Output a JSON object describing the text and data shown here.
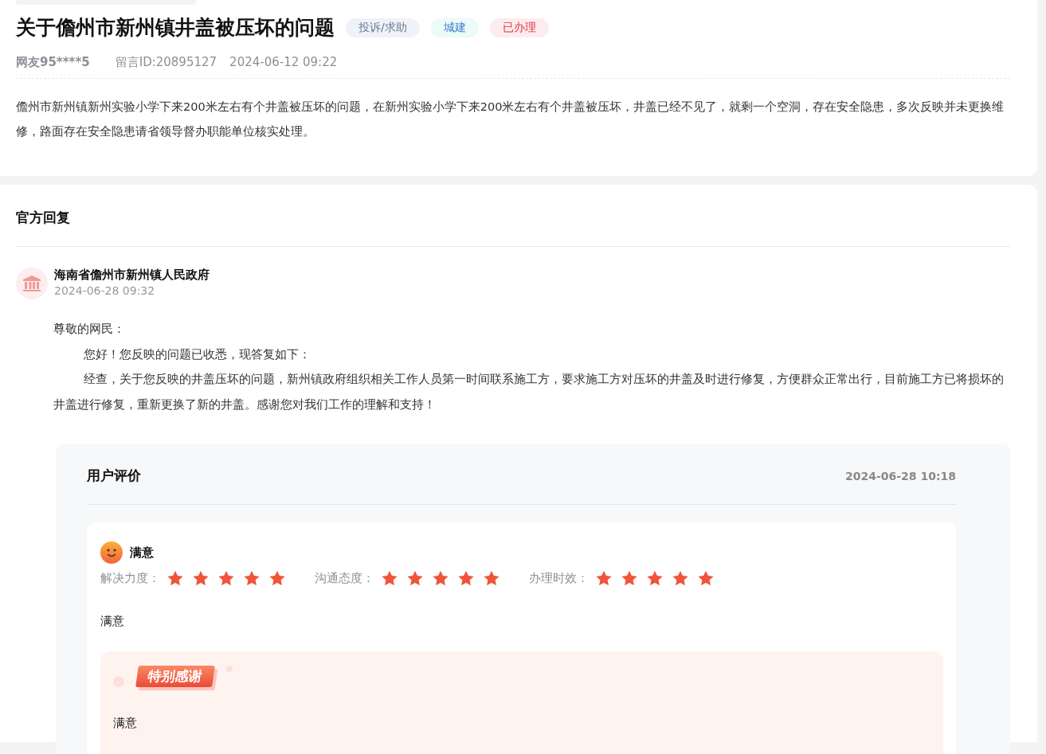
{
  "question": {
    "title": "关于儋州市新州镇井盖被压坏的问题",
    "tags": [
      {
        "label": "投诉/求助",
        "kind": "type"
      },
      {
        "label": "城建",
        "kind": "category"
      },
      {
        "label": "已办理",
        "kind": "status"
      }
    ],
    "author": "网友95****5",
    "message_id": "留言ID:20895127",
    "time": "2024-06-12 09:22",
    "content": "儋州市新州镇新州实验小学下来200米左右有个井盖被压坏的问题，在新州实验小学下来200米左右有个井盖被压坏，井盖已经不见了，就剩一个空洞，存在安全隐患，多次反映并未更换维修，路面存在安全隐患请省领导督办职能单位核实处理。"
  },
  "reply": {
    "heading": "官方回复",
    "organization": "海南省儋州市新州镇人民政府",
    "time": "2024-06-28 09:32",
    "paragraphs": [
      {
        "text": "尊敬的网民：",
        "kind": "plain"
      },
      {
        "text": "您好！您反映的问题已收悉，现答复如下：",
        "kind": "indent"
      },
      {
        "text": "经查，关于您反映的井盖压坏的问题，新州镇政府组织相关工作人员第一时间联系施工方，要求施工方对压坏的井盖及时进行修复，方便群众正常出行，目前施工方已将损坏的井盖进行修复，重新更换了新的井盖。感谢您对我们工作的理解和支持！",
        "kind": "indent"
      }
    ]
  },
  "evaluation": {
    "heading": "用户评价",
    "time": "2024-06-28 10:18",
    "verdict": "满意",
    "ratings": [
      {
        "label": "解决力度：",
        "stars": 5
      },
      {
        "label": "沟通态度：",
        "stars": 5
      },
      {
        "label": "办理时效：",
        "stars": 5
      }
    ],
    "comment": "满意",
    "thanks_badge": "特别感谢",
    "thanks_text": "满意"
  }
}
